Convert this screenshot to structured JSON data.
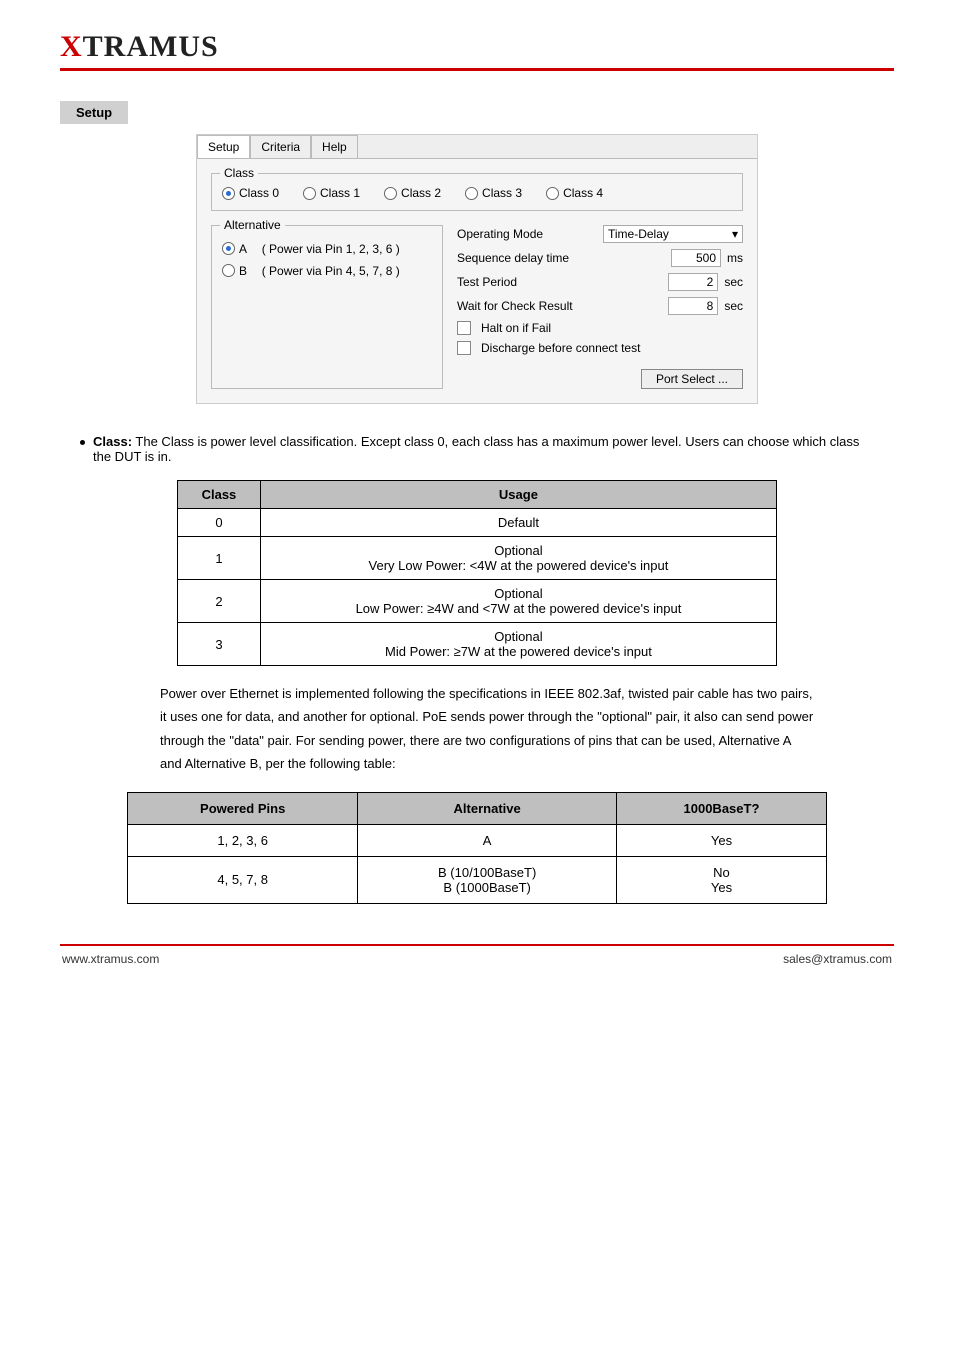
{
  "logo": "XTRAMUS",
  "tab_setup_label": "Setup",
  "screenshot": {
    "tabs": [
      {
        "name": "setup",
        "label": "Setup",
        "active": true
      },
      {
        "name": "criteria",
        "label": "Criteria",
        "active": false
      },
      {
        "name": "help",
        "label": "Help",
        "active": false
      }
    ],
    "class_legend": "Class",
    "class_options": [
      {
        "label": "Class 0",
        "selected": true
      },
      {
        "label": "Class 1",
        "selected": false
      },
      {
        "label": "Class 2",
        "selected": false
      },
      {
        "label": "Class 3",
        "selected": false
      },
      {
        "label": "Class 4",
        "selected": false
      }
    ],
    "alt_legend": "Alternative",
    "alt_options": [
      {
        "label": "A",
        "note": "( Power via Pin 1, 2, 3, 6 )",
        "selected": true
      },
      {
        "label": "B",
        "note": "( Power via Pin 4, 5, 7, 8 )",
        "selected": false
      }
    ],
    "op_mode": {
      "label": "Operating Mode",
      "value": "Time-Delay"
    },
    "seq_delay": {
      "label": "Sequence delay time",
      "value": "500",
      "unit": "ms"
    },
    "test_period": {
      "label": "Test Period",
      "value": "2",
      "unit": "sec"
    },
    "wait_check": {
      "label": "Wait for Check Result",
      "value": "8",
      "unit": "sec"
    },
    "halt": "Halt on if Fail",
    "discharge": "Discharge before connect test",
    "port_select": "Port Select ..."
  },
  "bullet": {
    "label": "Class:",
    "text": "The Class is power level classification. Except class 0, each class has a maximum power level. Users can choose which class the DUT is in."
  },
  "class_table": {
    "headers": [
      "Class",
      "Usage"
    ],
    "rows": [
      {
        "c": "0",
        "u": "Default"
      },
      {
        "c": "1",
        "u": "Optional\nVery Low Power: <4W at the powered device's input"
      },
      {
        "c": "2",
        "u": "Optional\nLow Power: ≥4W and <7W at the powered device's input"
      },
      {
        "c": "3",
        "u": "Optional\nMid Power: ≥7W at the powered device's input"
      }
    ]
  },
  "body_text": [
    "Power over Ethernet is implemented following the specifications in IEEE 802.3af, twisted pair cable has two pairs, it uses one for data, and another for optional. PoE sends power through the \"optional\" pair, it also can send power through the \"data\" pair. For sending power, there are two configurations of pins that can be used, Alternative A and Alternative B, per the following table:"
  ],
  "alt_table": {
    "headers": [
      "Powered Pins",
      "Alternative",
      "1000BaseT?"
    ],
    "rows": [
      {
        "p": "1, 2, 3, 6",
        "a": "A",
        "b": "Yes"
      },
      {
        "p": "4, 5, 7, 8",
        "a": "B (10/100BaseT)\nB (1000BaseT)",
        "b": "No\nYes"
      }
    ]
  },
  "footer": {
    "left": "www.xtramus.com",
    "right": "sales@xtramus.com"
  }
}
